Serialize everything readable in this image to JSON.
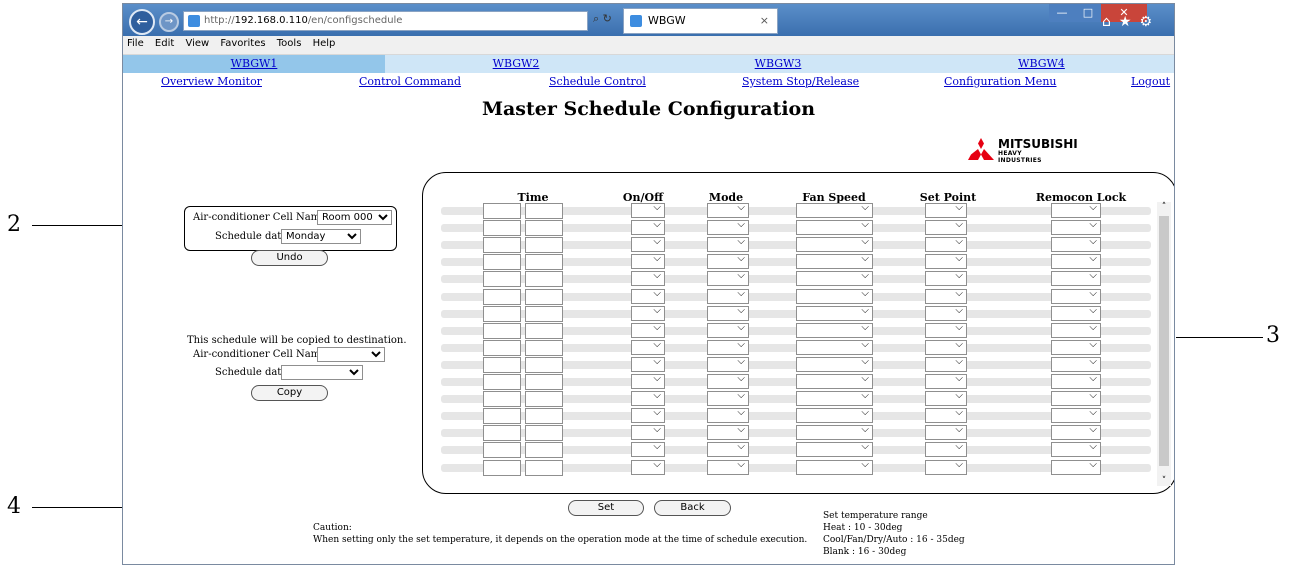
{
  "callouts": [
    "2",
    "3",
    "4"
  ],
  "browser": {
    "url_prefix": "http://",
    "url_host": "192.168.0.110",
    "url_path": "/en/configschedule",
    "tab_title": "WBGW",
    "menu": [
      "File",
      "Edit",
      "View",
      "Favorites",
      "Tools",
      "Help"
    ]
  },
  "wbgw_tabs": [
    "WBGW1",
    "WBGW2",
    "WBGW3",
    "WBGW4"
  ],
  "nav_links": [
    "Overview Monitor",
    "Control Command",
    "Schedule Control",
    "System Stop/Release",
    "Configuration Menu",
    "Logout"
  ],
  "page_title": "Master Schedule Configuration",
  "logo": {
    "name": "MITSUBISHI",
    "sub": "HEAVY INDUSTRIES",
    "color": "#e60012"
  },
  "source": {
    "cell_label": "Air-conditioner Cell Name:",
    "cell_value": "Room 000",
    "date_label": "Schedule date:",
    "date_value": "Monday",
    "undo_label": "Undo"
  },
  "copy": {
    "note": "This schedule will be copied to destination.",
    "cell_label": "Air-conditioner Cell Name:",
    "date_label": "Schedule date:",
    "copy_label": "Copy"
  },
  "schedule": {
    "columns": [
      "Time",
      "On/Off",
      "Mode",
      "Fan Speed",
      "Set Point",
      "Remocon Lock"
    ],
    "row_count": 16
  },
  "buttons": {
    "set": "Set",
    "back": "Back"
  },
  "caution": {
    "title": "Caution:",
    "text": "When setting only the set temperature, it depends on the operation mode at the time of schedule execution."
  },
  "temp_range": {
    "title": "Set temperature range",
    "lines": [
      "Heat : 10 - 30deg",
      "Cool/Fan/Dry/Auto : 16 - 35deg",
      "Blank : 16 - 30deg"
    ]
  }
}
